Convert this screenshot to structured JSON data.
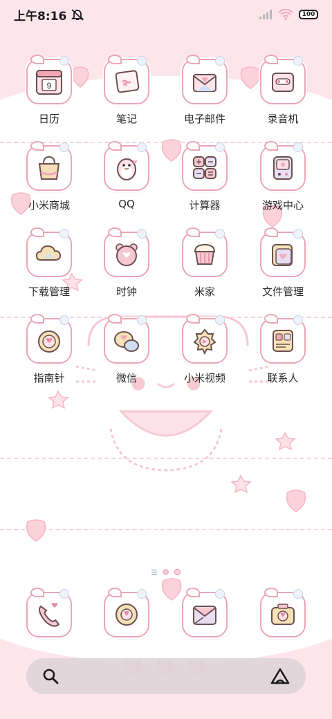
{
  "status_bar": {
    "time": "上午8:16",
    "battery": "100",
    "icons": [
      "mute-bell-icon",
      "signal-icon",
      "wifi-icon",
      "battery-icon"
    ]
  },
  "apps": [
    {
      "label": "日历",
      "icon": "calendar-icon",
      "badge": "9"
    },
    {
      "label": "笔记",
      "icon": "notes-icon"
    },
    {
      "label": "电子邮件",
      "icon": "email-icon"
    },
    {
      "label": "录音机",
      "icon": "recorder-icon"
    },
    {
      "label": "小米商城",
      "icon": "shopping-bag-icon"
    },
    {
      "label": "QQ",
      "icon": "penguin-icon"
    },
    {
      "label": "计算器",
      "icon": "calculator-icon"
    },
    {
      "label": "游戏中心",
      "icon": "game-console-icon"
    },
    {
      "label": "下载管理",
      "icon": "cloud-download-icon"
    },
    {
      "label": "时钟",
      "icon": "clock-icon"
    },
    {
      "label": "米家",
      "icon": "cupcake-icon"
    },
    {
      "label": "文件管理",
      "icon": "folder-icon"
    },
    {
      "label": "指南针",
      "icon": "compass-icon"
    },
    {
      "label": "微信",
      "icon": "chat-bubbles-icon"
    },
    {
      "label": "小米视频",
      "icon": "video-play-icon"
    },
    {
      "label": "联系人",
      "icon": "contacts-icon"
    }
  ],
  "dock": [
    {
      "icon": "phone-icon"
    },
    {
      "icon": "messages-icon"
    },
    {
      "icon": "browser-icon"
    },
    {
      "icon": "camera-icon"
    }
  ],
  "page_indicator": {
    "pages": 2,
    "active": 2
  },
  "search_bar": {
    "left_icon": "search-icon",
    "right_icon": "assistant-icon"
  },
  "colors": {
    "wallpaper_pink": "#fde6eb",
    "icon_border": "#e9a6b4",
    "label_text": "#2a2a2a"
  }
}
